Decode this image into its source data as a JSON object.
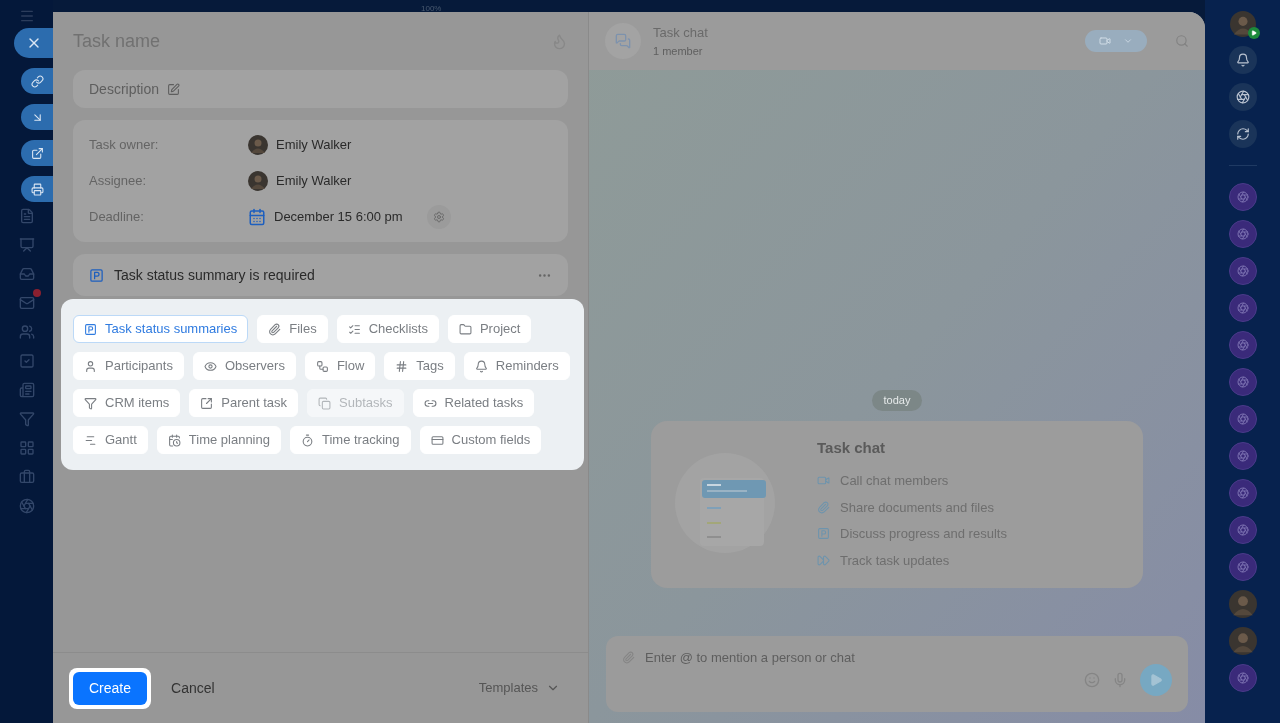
{
  "top_bar": {
    "zoom": "100%"
  },
  "form": {
    "title_placeholder": "Task name",
    "description_placeholder": "Description",
    "fields": [
      {
        "label": "Task owner:",
        "value": "Emily Walker",
        "kind": "person"
      },
      {
        "label": "Assignee:",
        "value": "Emily Walker",
        "kind": "person"
      },
      {
        "label": "Deadline:",
        "value": "December 15 6:00 pm",
        "kind": "date"
      }
    ],
    "summary_notice": "Task status summary is required",
    "chip_rows": [
      [
        {
          "label": "Task status summaries",
          "selected": true,
          "disabled": false
        },
        {
          "label": "Files",
          "selected": false,
          "disabled": false
        },
        {
          "label": "Checklists",
          "selected": false,
          "disabled": false
        },
        {
          "label": "Project",
          "selected": false,
          "disabled": false
        }
      ],
      [
        {
          "label": "Participants",
          "selected": false,
          "disabled": false
        },
        {
          "label": "Observers",
          "selected": false,
          "disabled": false
        },
        {
          "label": "Flow",
          "selected": false,
          "disabled": false
        },
        {
          "label": "Tags",
          "selected": false,
          "disabled": false
        },
        {
          "label": "Reminders",
          "selected": false,
          "disabled": false
        }
      ],
      [
        {
          "label": "CRM items",
          "selected": false,
          "disabled": false
        },
        {
          "label": "Parent task",
          "selected": false,
          "disabled": false
        },
        {
          "label": "Subtasks",
          "selected": false,
          "disabled": true
        },
        {
          "label": "Related tasks",
          "selected": false,
          "disabled": false
        }
      ],
      [
        {
          "label": "Gantt",
          "selected": false,
          "disabled": false
        },
        {
          "label": "Time planning",
          "selected": false,
          "disabled": false
        },
        {
          "label": "Time tracking",
          "selected": false,
          "disabled": false
        },
        {
          "label": "Custom fields",
          "selected": false,
          "disabled": false
        }
      ]
    ],
    "buttons": {
      "create": "Create",
      "cancel": "Cancel",
      "templates": "Templates"
    }
  },
  "chat": {
    "title": "Task chat",
    "subtitle": "1 member",
    "date_divider": "today",
    "intro": {
      "title": "Task chat",
      "features": [
        "Call chat members",
        "Share documents and files",
        "Discuss progress and results",
        "Track task updates"
      ]
    },
    "input_placeholder": "Enter @ to mention a person or chat"
  }
}
